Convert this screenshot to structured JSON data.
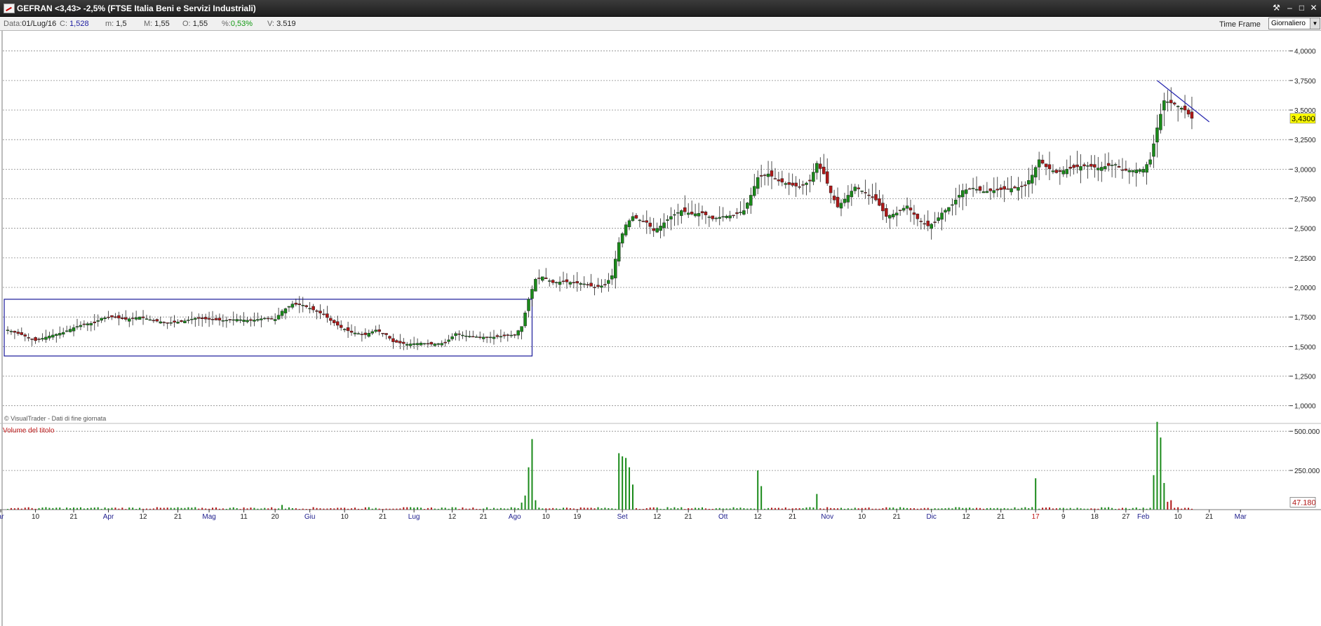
{
  "window": {
    "title": "GEFRAN <3,43> -2,5%  (FTSE Italia Beni e Servizi Industriali)",
    "buttons": [
      "tools-icon",
      "minimize-icon",
      "restore-icon",
      "close-icon"
    ]
  },
  "infobar": {
    "data_label": "Data:",
    "data_value": "01/Lug/16",
    "close_label": "C:",
    "close_value": "1,528",
    "min_label": "m:",
    "min_value": "1,5",
    "max_label": "M:",
    "max_value": "1,55",
    "open_label": "O:",
    "open_value": "1,55",
    "pct_label": "%:",
    "pct_value": "0,53%",
    "vol_label": "V:",
    "vol_value": "3.519",
    "timeframe_label": "Time Frame",
    "timeframe_value": "Giornaliero"
  },
  "colors": {
    "up": "#1a8a1a",
    "down": "#b01818",
    "box": "#1a1a9a",
    "trend": "#2a2ab0",
    "grid": "#8a8a8a",
    "last_price_bg": "#ffff00"
  },
  "chart_data": {
    "type": "candlestick",
    "watermark": "© VisualTrader - Dati di fine giornata",
    "y_axis": {
      "range": [
        0.85,
        4.17
      ],
      "ticks": [
        "1,0000",
        "1,2500",
        "1,5000",
        "1,7500",
        "2,0000",
        "2,2500",
        "2,5000",
        "2,7500",
        "3,0000",
        "3,2500",
        "3,5000",
        "3,7500",
        "4,0000"
      ]
    },
    "last_price_label": "3,4300",
    "last_price": 3.43,
    "volume_panel": {
      "title": "Volume del titolo",
      "range": [
        0,
        550000
      ],
      "ticks": [
        {
          "label": "500.000",
          "value": 500000
        },
        {
          "label": "250.000",
          "value": 250000
        }
      ],
      "last_label": "47.180",
      "last_value": 47180
    },
    "x_axis": {
      "labels": [
        {
          "label": "ar",
          "d": -2
        },
        {
          "label": "10",
          "d": 8
        },
        {
          "label": "21",
          "d": 19
        },
        {
          "label": "Apr",
          "d": 29
        },
        {
          "label": "12",
          "d": 39
        },
        {
          "label": "21",
          "d": 49
        },
        {
          "label": "Mag",
          "d": 58
        },
        {
          "label": "11",
          "d": 68
        },
        {
          "label": "20",
          "d": 77
        },
        {
          "label": "Giu",
          "d": 87
        },
        {
          "label": "10",
          "d": 97
        },
        {
          "label": "21",
          "d": 108
        },
        {
          "label": "Lug",
          "d": 117
        },
        {
          "label": "12",
          "d": 128
        },
        {
          "label": "21",
          "d": 137
        },
        {
          "label": "Ago",
          "d": 146
        },
        {
          "label": "10",
          "d": 155
        },
        {
          "label": "19",
          "d": 164
        },
        {
          "label": "Set",
          "d": 177
        },
        {
          "label": "12",
          "d": 187
        },
        {
          "label": "21",
          "d": 196
        },
        {
          "label": "Ott",
          "d": 206
        },
        {
          "label": "12",
          "d": 216
        },
        {
          "label": "21",
          "d": 226
        },
        {
          "label": "Nov",
          "d": 236
        },
        {
          "label": "10",
          "d": 246
        },
        {
          "label": "21",
          "d": 256
        },
        {
          "label": "Dic",
          "d": 266
        },
        {
          "label": "12",
          "d": 276
        },
        {
          "label": "21",
          "d": 286
        },
        {
          "label": "17",
          "d": 296
        },
        {
          "label": "9",
          "d": 304
        },
        {
          "label": "18",
          "d": 313
        },
        {
          "label": "27",
          "d": 322
        },
        {
          "label": "Feb",
          "d": 327
        },
        {
          "label": "10",
          "d": 337
        },
        {
          "label": "21",
          "d": 346
        },
        {
          "label": "Mar",
          "d": 355
        }
      ]
    },
    "anchors": [
      [
        0,
        1.64
      ],
      [
        4,
        1.6
      ],
      [
        8,
        1.55
      ],
      [
        12,
        1.59
      ],
      [
        16,
        1.62
      ],
      [
        19,
        1.66
      ],
      [
        22,
        1.69
      ],
      [
        25,
        1.7
      ],
      [
        27,
        1.74
      ],
      [
        30,
        1.75
      ],
      [
        34,
        1.73
      ],
      [
        38,
        1.75
      ],
      [
        42,
        1.72
      ],
      [
        46,
        1.7
      ],
      [
        50,
        1.71
      ],
      [
        54,
        1.74
      ],
      [
        58,
        1.73
      ],
      [
        62,
        1.72
      ],
      [
        66,
        1.73
      ],
      [
        70,
        1.72
      ],
      [
        74,
        1.74
      ],
      [
        77,
        1.73
      ],
      [
        79,
        1.8
      ],
      [
        82,
        1.86
      ],
      [
        85,
        1.85
      ],
      [
        88,
        1.81
      ],
      [
        91,
        1.77
      ],
      [
        93,
        1.72
      ],
      [
        96,
        1.66
      ],
      [
        99,
        1.62
      ],
      [
        103,
        1.6
      ],
      [
        106,
        1.64
      ],
      [
        109,
        1.6
      ],
      [
        111,
        1.54
      ],
      [
        115,
        1.52
      ],
      [
        119,
        1.53
      ],
      [
        122,
        1.52
      ],
      [
        126,
        1.53
      ],
      [
        129,
        1.61
      ],
      [
        132,
        1.59
      ],
      [
        136,
        1.58
      ],
      [
        140,
        1.58
      ],
      [
        143,
        1.59
      ],
      [
        146,
        1.6
      ],
      [
        148,
        1.67
      ],
      [
        150,
        1.9
      ],
      [
        152,
        2.07
      ],
      [
        154,
        2.09
      ],
      [
        157,
        2.04
      ],
      [
        160,
        2.05
      ],
      [
        163,
        2.04
      ],
      [
        166,
        2.03
      ],
      [
        169,
        2.0
      ],
      [
        172,
        2.02
      ],
      [
        174,
        2.1
      ],
      [
        176,
        2.38
      ],
      [
        178,
        2.53
      ],
      [
        180,
        2.6
      ],
      [
        182,
        2.57
      ],
      [
        184,
        2.55
      ],
      [
        186,
        2.48
      ],
      [
        188,
        2.52
      ],
      [
        191,
        2.6
      ],
      [
        194,
        2.65
      ],
      [
        197,
        2.62
      ],
      [
        200,
        2.63
      ],
      [
        203,
        2.58
      ],
      [
        206,
        2.6
      ],
      [
        209,
        2.61
      ],
      [
        212,
        2.65
      ],
      [
        214,
        2.78
      ],
      [
        216,
        2.93
      ],
      [
        219,
        2.96
      ],
      [
        222,
        2.9
      ],
      [
        225,
        2.87
      ],
      [
        228,
        2.85
      ],
      [
        231,
        2.9
      ],
      [
        233,
        3.05
      ],
      [
        235,
        2.96
      ],
      [
        237,
        2.8
      ],
      [
        239,
        2.68
      ],
      [
        242,
        2.78
      ],
      [
        244,
        2.85
      ],
      [
        247,
        2.8
      ],
      [
        250,
        2.74
      ],
      [
        253,
        2.6
      ],
      [
        256,
        2.63
      ],
      [
        259,
        2.69
      ],
      [
        262,
        2.58
      ],
      [
        265,
        2.52
      ],
      [
        267,
        2.55
      ],
      [
        269,
        2.63
      ],
      [
        272,
        2.7
      ],
      [
        275,
        2.82
      ],
      [
        278,
        2.84
      ],
      [
        281,
        2.81
      ],
      [
        284,
        2.82
      ],
      [
        287,
        2.83
      ],
      [
        290,
        2.84
      ],
      [
        293,
        2.86
      ],
      [
        295,
        2.95
      ],
      [
        297,
        3.08
      ],
      [
        299,
        3.02
      ],
      [
        302,
        2.97
      ],
      [
        305,
        3.0
      ],
      [
        308,
        3.02
      ],
      [
        311,
        3.03
      ],
      [
        314,
        3.01
      ],
      [
        317,
        3.03
      ],
      [
        319,
        3.04
      ],
      [
        321,
        2.99
      ],
      [
        324,
        2.99
      ],
      [
        327,
        3.0
      ],
      [
        329,
        3.08
      ],
      [
        331,
        3.35
      ],
      [
        333,
        3.58
      ],
      [
        336,
        3.55
      ],
      [
        339,
        3.5
      ],
      [
        341,
        3.43
      ]
    ],
    "volume_spikes": [
      [
        79,
        30000
      ],
      [
        148,
        45000
      ],
      [
        149,
        90000
      ],
      [
        150,
        270000
      ],
      [
        151,
        450000
      ],
      [
        152,
        60000
      ],
      [
        176,
        360000
      ],
      [
        177,
        340000
      ],
      [
        178,
        330000
      ],
      [
        179,
        270000
      ],
      [
        180,
        160000
      ],
      [
        216,
        250000
      ],
      [
        217,
        150000
      ],
      [
        233,
        100000
      ],
      [
        296,
        200000
      ],
      [
        330,
        220000
      ],
      [
        331,
        560000
      ],
      [
        332,
        460000
      ],
      [
        333,
        170000
      ],
      [
        334,
        50000
      ],
      [
        335,
        60000
      ]
    ],
    "trendline": [
      {
        "d": 331,
        "p": 3.75
      },
      {
        "d": 346,
        "p": 3.4
      }
    ],
    "box": {
      "d_start": -1,
      "d_end": 151,
      "p_top": 1.9,
      "p_bottom": 1.42
    }
  }
}
